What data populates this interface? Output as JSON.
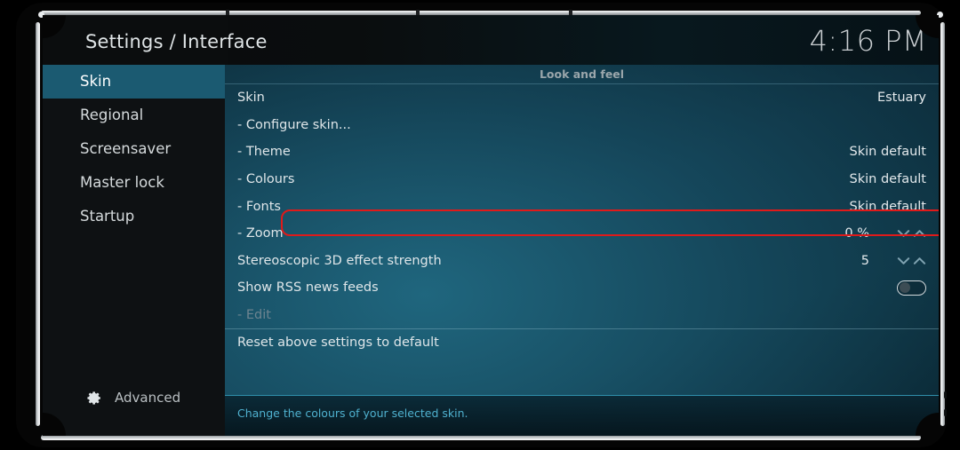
{
  "window": {
    "title": "Settings / Interface",
    "clock": "4:16 PM"
  },
  "sidebar": {
    "items": [
      {
        "label": "Skin",
        "selected": true
      },
      {
        "label": "Regional",
        "selected": false
      },
      {
        "label": "Screensaver",
        "selected": false
      },
      {
        "label": "Master lock",
        "selected": false
      },
      {
        "label": "Startup",
        "selected": false
      }
    ],
    "advanced_label": "Advanced",
    "gear_icon": "gear-icon"
  },
  "content": {
    "group_header": "Look and feel",
    "rows": [
      {
        "label": "Skin",
        "value": "Estuary",
        "type": "value"
      },
      {
        "label": "- Configure skin...",
        "value": "",
        "type": "action"
      },
      {
        "label": "- Theme",
        "value": "Skin default",
        "type": "value"
      },
      {
        "label": "- Colours",
        "value": "Skin default",
        "type": "value"
      },
      {
        "label": "- Fonts",
        "value": "Skin default",
        "type": "value",
        "focused": true
      },
      {
        "label": "- Zoom",
        "value": "0 %",
        "type": "spinner"
      },
      {
        "label": "Stereoscopic 3D effect strength",
        "value": "5",
        "type": "spinner"
      },
      {
        "label": "Show RSS news feeds",
        "value": "",
        "type": "toggle",
        "toggle_on": false
      },
      {
        "label": "- Edit",
        "value": "",
        "type": "action",
        "disabled": true
      },
      {
        "label": "Reset above settings to default",
        "value": "",
        "type": "action",
        "divider": true
      }
    ]
  },
  "footer": {
    "help_text": "Change the colours of your selected skin."
  },
  "colors": {
    "accent": "#1b5a71",
    "highlight_ring": "#e01a1a",
    "footer_text": "#4fb1cf",
    "sidebar_bg": "#0e1113"
  }
}
